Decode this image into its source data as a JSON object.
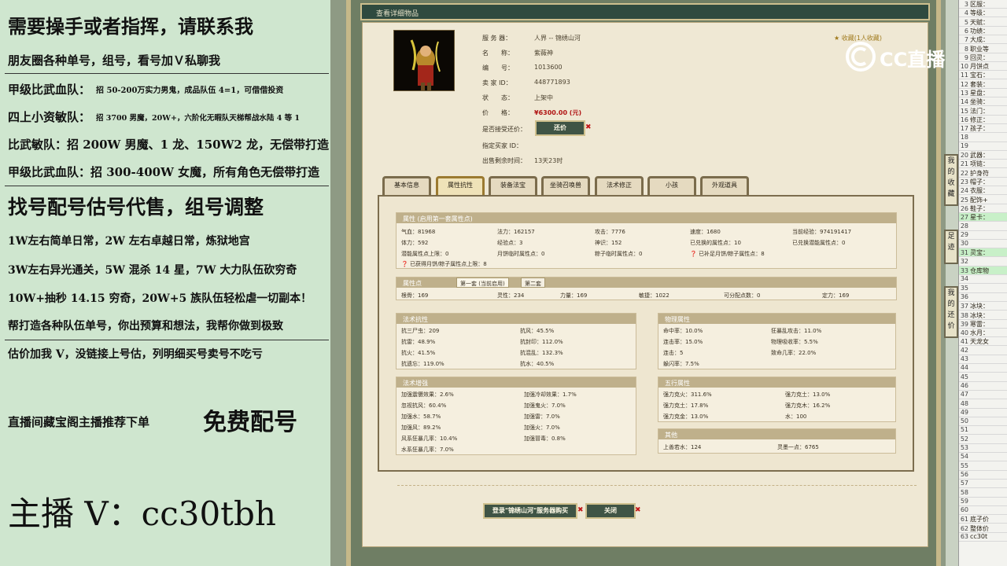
{
  "overlay": {
    "lines": [
      "需要操手或者指挥，请联系我",
      "朋友圈各种单号，组号，看号加Ｖ私聊我",
      "甲级比武血队：",
      "招 50-200万实力男鬼，成品队伍 4=1，可借借投资",
      "四上小资敏队：",
      "招 3700 男魔，20W+，六阶化无暇队天梯帮战水陆 4 等 1",
      "比武敏队：招 200W 男魔、1 龙、150W2 龙，无偿带打造",
      "甲级比武血队：招 300-400W 女魔，所有角色无偿带打造",
      "找号配号估号代售，组号调整",
      "1W左右简单日常，2W 左右卓越日常，炼狱地宫",
      "3W左右异光通关，5W 混杀 14 星，7W 大力队伍砍穷奇",
      "10W+抽秒 14.15 穷奇，20W+5 族队伍轻松虐一切副本！",
      "帮打造各种队伍单号，你出预算和想法，我帮你做到极致",
      "估价加我 V，没链接上号估，列明细买号卖号不吃亏",
      "直播间藏宝阁主播推荐下单",
      "免费配号",
      "主播 V：cc30tbh"
    ]
  },
  "window": {
    "title": "查看详细物品",
    "fav": "收藏(1人收藏)"
  },
  "item": {
    "server_label": "服 务 器：",
    "server": "人界 -- 锦绣山河",
    "name_label": "名　　称：",
    "name": "紫薇神",
    "id_label": "编　　号：",
    "id": "1013600",
    "seller_label": "卖 家 ID：",
    "seller": "448771893",
    "status_label": "状　　态：",
    "status": "上架中",
    "price_label": "价　　格：",
    "price": "¥6300.00 (元)",
    "bargain_label": "是否接受还价：",
    "bargain_button": "还价",
    "buyer_label": "指定买家 ID：",
    "time_label": "出售剩余时间：",
    "time": "13天23时"
  },
  "tabs": [
    "基本信息",
    "属性抗性",
    "装备法宝",
    "坐骑召唤兽",
    "法术修正",
    "小孩",
    "外观道具"
  ],
  "attributes": {
    "title": "属性 (启用第一套属性点)",
    "rows": [
      [
        "气血：81968",
        "法力：162157",
        "攻击：7776",
        "速度：1680",
        "当前经验：974191417"
      ],
      [
        "体力：592",
        "经验点：3",
        "神识：152",
        "已兑换的属性点：10",
        "已兑换潜能属性点：0"
      ],
      [
        "潜能属性点上限：0",
        "月饼临时属性点：0",
        "粽子临时属性点：0",
        "已补足月饼/粽子属性点：8",
        ""
      ]
    ],
    "note": "已获得月饼/粽子属性点上限：8"
  },
  "points": {
    "title": "属性点",
    "subtabs": [
      "第一套 (当前启用)",
      "第二套"
    ],
    "values": [
      "根骨：169",
      "灵性：234",
      "力量：169",
      "敏捷：1022",
      "可分配点数：0",
      "定力：169"
    ]
  },
  "resist": {
    "title": "法术抗性",
    "rows": [
      [
        "抗三尸虫：209",
        "抗风：45.5%"
      ],
      [
        "抗雷：48.9%",
        "抗封印：112.0%"
      ],
      [
        "抗火：41.5%",
        "抗混乱：132.3%"
      ],
      [
        "抗遗忘：119.0%",
        "抗水：40.5%"
      ]
    ]
  },
  "physical": {
    "title": "物理属性",
    "rows": [
      [
        "命中率：10.0%",
        "狂暴乱攻击：11.0%"
      ],
      [
        "连击率：15.0%",
        "物理吸收率：5.5%"
      ],
      [
        "连击：5",
        "致命几率：22.0%"
      ],
      [
        "躲闪率：7.5%",
        ""
      ]
    ]
  },
  "boost": {
    "title": "法术增强",
    "rows": [
      [
        "加强震慑效果：2.6%",
        "加强冷却效果：1.7%"
      ],
      [
        "忽视抗风：60.4%",
        "加强鬼火：7.0%"
      ],
      [
        "加强水：58.7%",
        "加强雷：7.0%"
      ],
      [
        "加强风：89.2%",
        "加强火：7.0%"
      ],
      [
        "风系狂暴几率：10.4%",
        "加强冒毒：0.8%"
      ],
      [
        "水系狂暴几率：7.0%",
        ""
      ]
    ]
  },
  "wuxing": {
    "title": "五行属性",
    "rows": [
      [
        "强力克火：311.6%",
        "强力克土：13.0%"
      ],
      [
        "强力克土：17.8%",
        "强力克木：16.2%"
      ],
      [
        "强力克金：13.0%",
        "水：100"
      ]
    ]
  },
  "other": {
    "title": "其他",
    "rows": [
      [
        "上善若水：124",
        "灵墨一点：6765"
      ]
    ]
  },
  "buttons": {
    "buy": "登录\"锦绣山河\"服务器购买",
    "close": "关闭"
  },
  "side": {
    "fav": "我的收藏",
    "foot": "足迹",
    "bargain": "我的还价"
  },
  "sheet": {
    "rows": [
      {
        "n": "3",
        "t": "区服：",
        "hl": false
      },
      {
        "n": "4",
        "t": "等级：",
        "hl": false
      },
      {
        "n": "5",
        "t": "天赋：",
        "hl": false
      },
      {
        "n": "6",
        "t": "功绩：",
        "hl": false
      },
      {
        "n": "7",
        "t": "大成：",
        "hl": false
      },
      {
        "n": "8",
        "t": "职业等",
        "hl": false
      },
      {
        "n": "9",
        "t": "回灵：",
        "hl": false
      },
      {
        "n": "10",
        "t": "月饼点",
        "hl": false
      },
      {
        "n": "11",
        "t": "宝石：",
        "hl": false
      },
      {
        "n": "12",
        "t": "套装：",
        "hl": false
      },
      {
        "n": "13",
        "t": "星盘：",
        "hl": false
      },
      {
        "n": "14",
        "t": "坐骑：",
        "hl": false
      },
      {
        "n": "15",
        "t": "法门：",
        "hl": false
      },
      {
        "n": "16",
        "t": "修正：",
        "hl": false
      },
      {
        "n": "17",
        "t": "孩子：",
        "hl": false
      },
      {
        "n": "18",
        "t": "",
        "hl": false
      },
      {
        "n": "19",
        "t": "",
        "hl": false
      },
      {
        "n": "20",
        "t": "武器：",
        "hl": false
      },
      {
        "n": "21",
        "t": "项链：",
        "hl": false
      },
      {
        "n": "22",
        "t": "护身符",
        "hl": false
      },
      {
        "n": "23",
        "t": "帽子：",
        "hl": false
      },
      {
        "n": "24",
        "t": "衣服：",
        "hl": false
      },
      {
        "n": "25",
        "t": "配饰+",
        "hl": false
      },
      {
        "n": "26",
        "t": "鞋子：",
        "hl": false
      },
      {
        "n": "27",
        "t": "星卡：",
        "hl": true
      },
      {
        "n": "28",
        "t": "",
        "hl": false
      },
      {
        "n": "29",
        "t": "",
        "hl": false
      },
      {
        "n": "30",
        "t": "",
        "hl": false
      },
      {
        "n": "31",
        "t": "灵宝：",
        "hl": true
      },
      {
        "n": "32",
        "t": "",
        "hl": false
      },
      {
        "n": "33",
        "t": "仓库物",
        "hl": true
      },
      {
        "n": "34",
        "t": "",
        "hl": false
      },
      {
        "n": "35",
        "t": "",
        "hl": false
      },
      {
        "n": "36",
        "t": "",
        "hl": false
      },
      {
        "n": "37",
        "t": "冰块：",
        "hl": false
      },
      {
        "n": "38",
        "t": "冰块：",
        "hl": false
      },
      {
        "n": "39",
        "t": "寒雷：",
        "hl": false
      },
      {
        "n": "40",
        "t": "水月：",
        "hl": false
      },
      {
        "n": "41",
        "t": "天龙女",
        "hl": false
      },
      {
        "n": "42",
        "t": "",
        "hl": false
      },
      {
        "n": "43",
        "t": "",
        "hl": false
      },
      {
        "n": "44",
        "t": "",
        "hl": false
      },
      {
        "n": "45",
        "t": "",
        "hl": false
      },
      {
        "n": "46",
        "t": "",
        "hl": false
      },
      {
        "n": "47",
        "t": "",
        "hl": false
      },
      {
        "n": "48",
        "t": "",
        "hl": false
      },
      {
        "n": "49",
        "t": "",
        "hl": false
      },
      {
        "n": "50",
        "t": "",
        "hl": false
      },
      {
        "n": "51",
        "t": "",
        "hl": false
      },
      {
        "n": "52",
        "t": "",
        "hl": false
      },
      {
        "n": "53",
        "t": "",
        "hl": false
      },
      {
        "n": "54",
        "t": "",
        "hl": false
      },
      {
        "n": "55",
        "t": "",
        "hl": false
      },
      {
        "n": "56",
        "t": "",
        "hl": false
      },
      {
        "n": "57",
        "t": "",
        "hl": false
      },
      {
        "n": "58",
        "t": "",
        "hl": false
      },
      {
        "n": "59",
        "t": "",
        "hl": false
      },
      {
        "n": "60",
        "t": "",
        "hl": false
      },
      {
        "n": "61",
        "t": "底子价",
        "hl": false
      },
      {
        "n": "62",
        "t": "整体价",
        "hl": false
      },
      {
        "n": "63",
        "t": "cc30t",
        "hl": false
      }
    ]
  },
  "watermark": "CC直播"
}
